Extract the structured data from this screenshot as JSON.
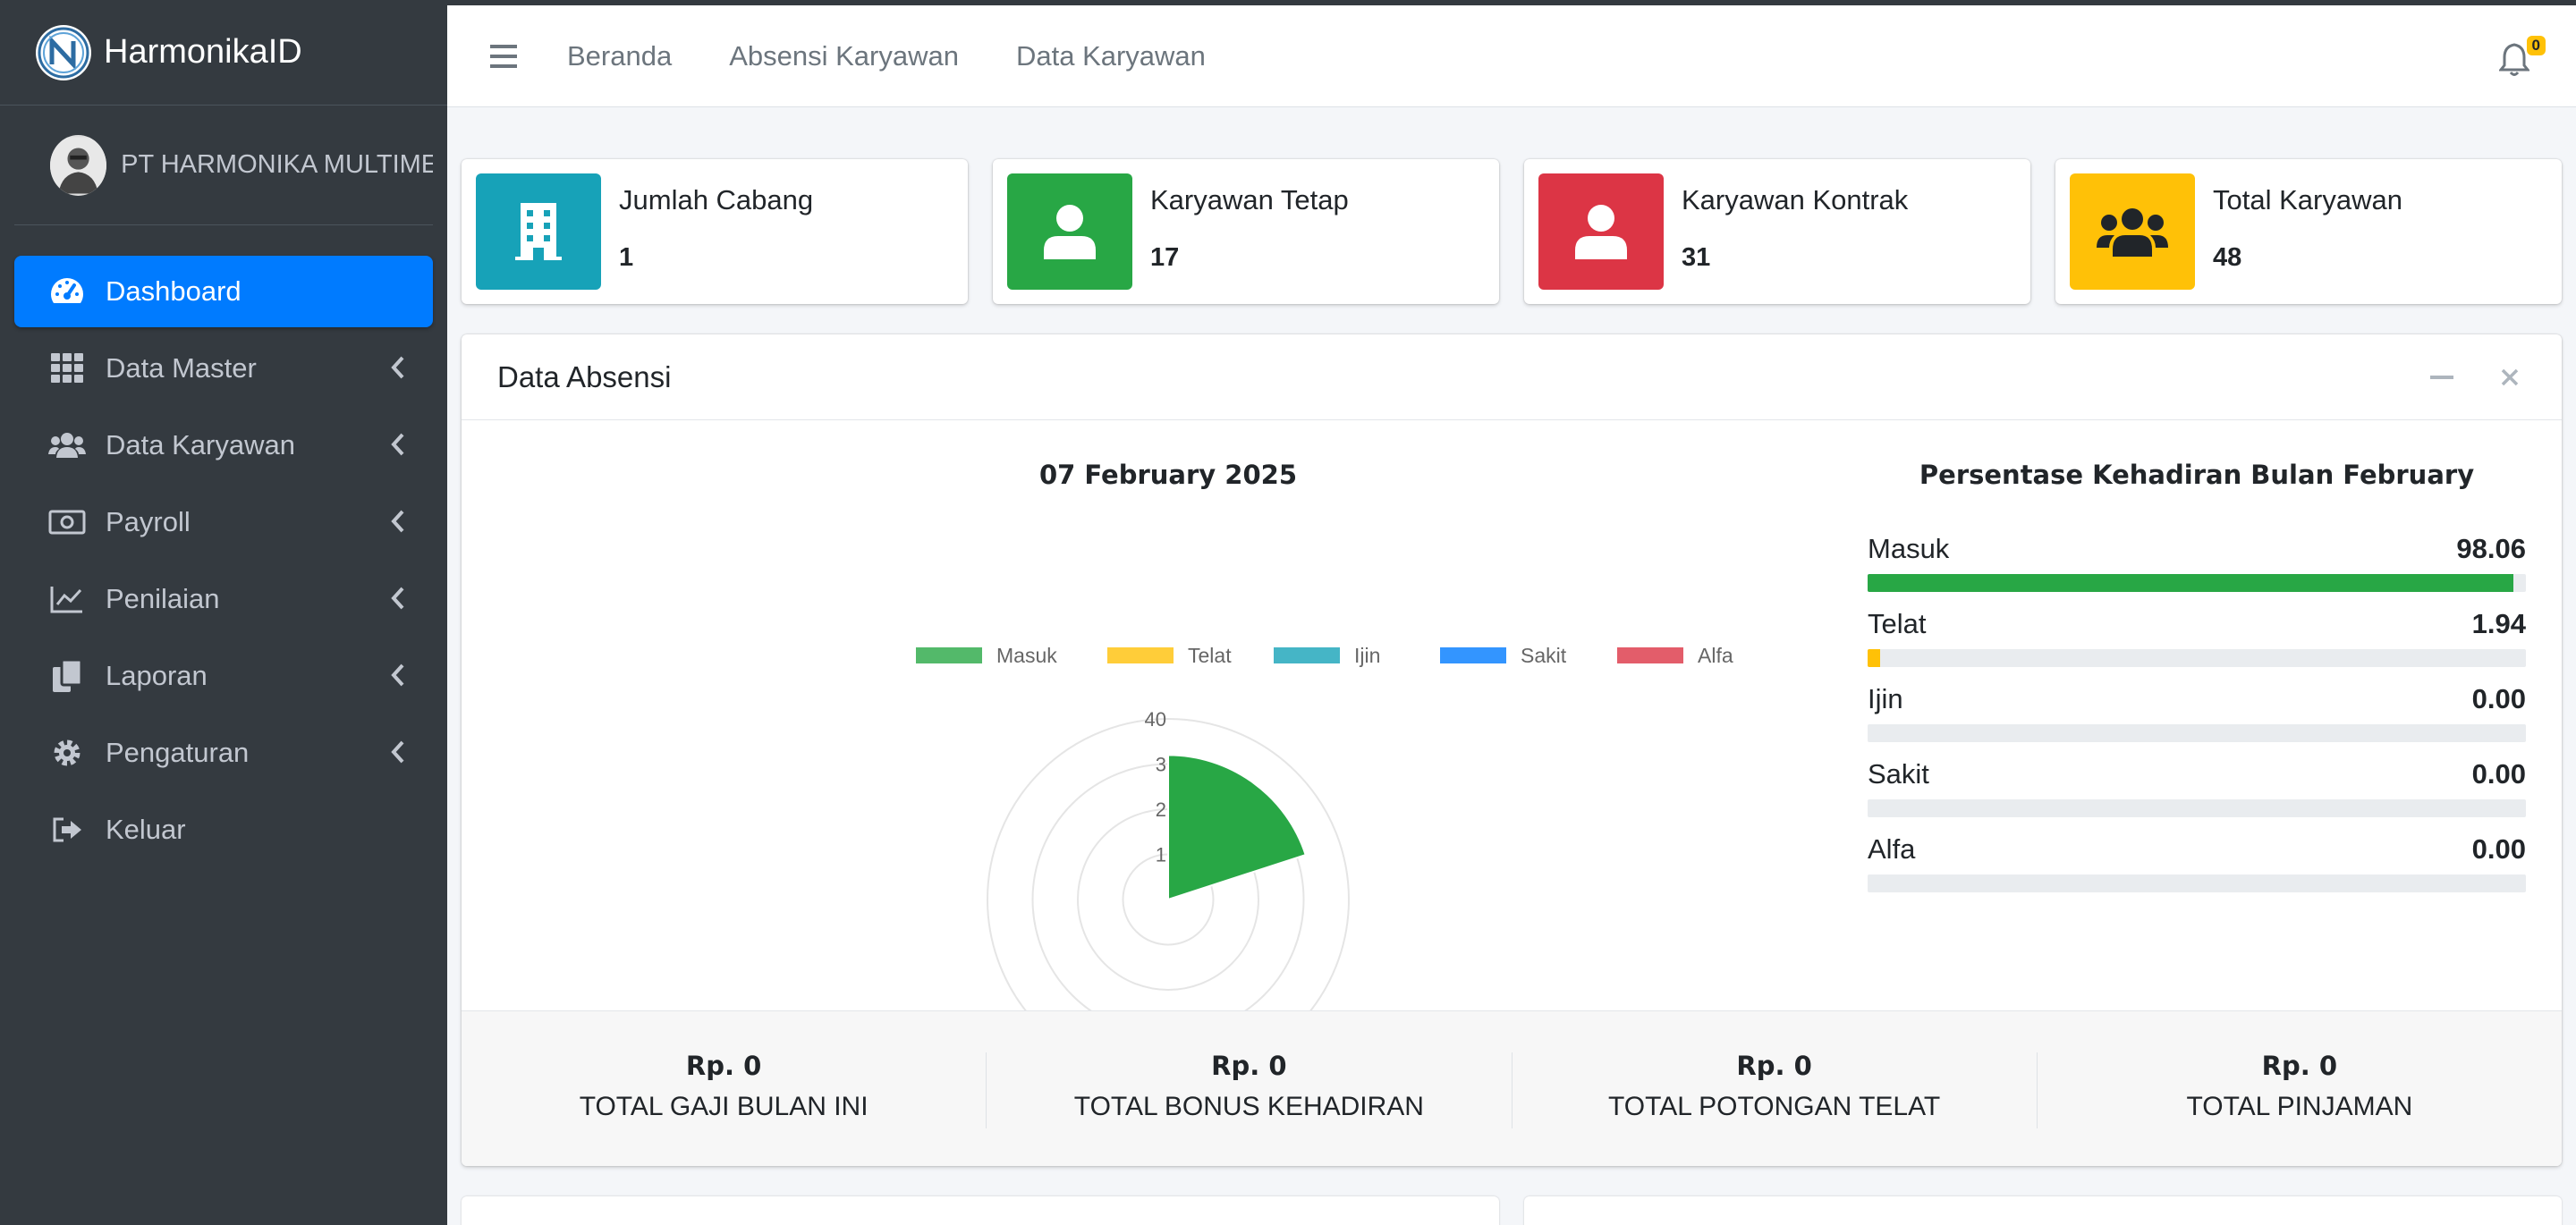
{
  "brand": {
    "name": "HarmonikaID"
  },
  "user": {
    "name": "PT HARMONIKA MULTIMED"
  },
  "sidebar": {
    "items": [
      {
        "label": "Dashboard",
        "icon": "tachometer-icon",
        "active": true
      },
      {
        "label": "Data Master",
        "icon": "grid-icon"
      },
      {
        "label": "Data Karyawan",
        "icon": "users-icon"
      },
      {
        "label": "Payroll",
        "icon": "money-icon"
      },
      {
        "label": "Penilaian",
        "icon": "chart-line-icon"
      },
      {
        "label": "Laporan",
        "icon": "copy-icon"
      },
      {
        "label": "Pengaturan",
        "icon": "gear-icon"
      },
      {
        "label": "Keluar",
        "icon": "sign-out-icon"
      }
    ]
  },
  "header": {
    "links": [
      "Beranda",
      "Absensi Karyawan",
      "Data Karyawan"
    ],
    "notifications": "0"
  },
  "info_boxes": [
    {
      "label": "Jumlah Cabang",
      "value": "1",
      "color": "#17a2b8",
      "icon": "building-icon"
    },
    {
      "label": "Karyawan Tetap",
      "value": "17",
      "color": "#28a745",
      "icon": "user-icon"
    },
    {
      "label": "Karyawan Kontrak",
      "value": "31",
      "color": "#dc3545",
      "icon": "user-icon"
    },
    {
      "label": "Total Karyawan",
      "value": "48",
      "color": "#ffc107",
      "icon": "users-icon"
    }
  ],
  "card": {
    "title": "Data Absensi",
    "chart_title": "07 February 2025",
    "progress_title": "Persentase Kehadiran Bulan February",
    "progress": [
      {
        "label": "Masuk",
        "value": "98.06",
        "percent": 98.06,
        "color": "#28a745"
      },
      {
        "label": "Telat",
        "value": "1.94",
        "percent": 1.94,
        "color": "#ffc107"
      },
      {
        "label": "Ijin",
        "value": "0.00",
        "percent": 0,
        "color": "#17a2b8"
      },
      {
        "label": "Sakit",
        "value": "0.00",
        "percent": 0,
        "color": "#007bff"
      },
      {
        "label": "Alfa",
        "value": "0.00",
        "percent": 0,
        "color": "#dc3545"
      }
    ],
    "footer": [
      {
        "amount": "Rp. 0",
        "label": "TOTAL GAJI BULAN INI"
      },
      {
        "amount": "Rp. 0",
        "label": "TOTAL BONUS KEHADIRAN"
      },
      {
        "amount": "Rp. 0",
        "label": "TOTAL POTONGAN TELAT"
      },
      {
        "amount": "Rp. 0",
        "label": "TOTAL PINJAMAN"
      }
    ]
  },
  "chart_data": {
    "type": "polarArea",
    "title": "07 February 2025",
    "categories": [
      "Masuk",
      "Telat",
      "Ijin",
      "Sakit",
      "Alfa"
    ],
    "values": [
      3.2,
      0,
      0,
      0,
      0
    ],
    "colors": [
      "#28a745",
      "#ffc107",
      "#17a2b8",
      "#007bff",
      "#dc3545"
    ],
    "r_ticks": [
      "1",
      "2",
      "3",
      "40"
    ],
    "rlim": [
      0,
      4
    ],
    "legend": "top"
  }
}
